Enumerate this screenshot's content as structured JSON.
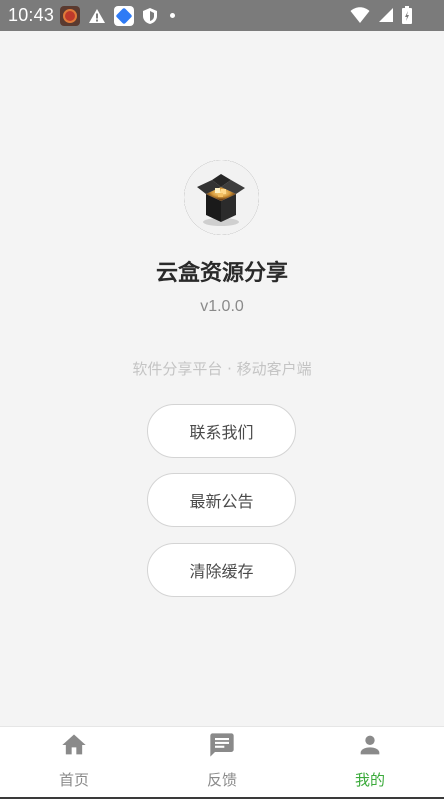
{
  "status_bar": {
    "time": "10:43"
  },
  "profile": {
    "app_name": "云盒资源分享",
    "version": "v1.0.0",
    "tagline": "软件分享平台 · 移动客户端"
  },
  "actions": {
    "contact_label": "联系我们",
    "announcement_label": "最新公告",
    "clear_cache_label": "清除缓存"
  },
  "bottom_nav": {
    "items": [
      {
        "label": "首页",
        "icon": "home-icon"
      },
      {
        "label": "反馈",
        "icon": "feedback-icon"
      },
      {
        "label": "我的",
        "icon": "person-icon"
      }
    ],
    "active_index": 2
  },
  "colors": {
    "accent": "#3aaa3a",
    "status_bar": "#7b7b7b",
    "background": "#f4f4f4"
  }
}
